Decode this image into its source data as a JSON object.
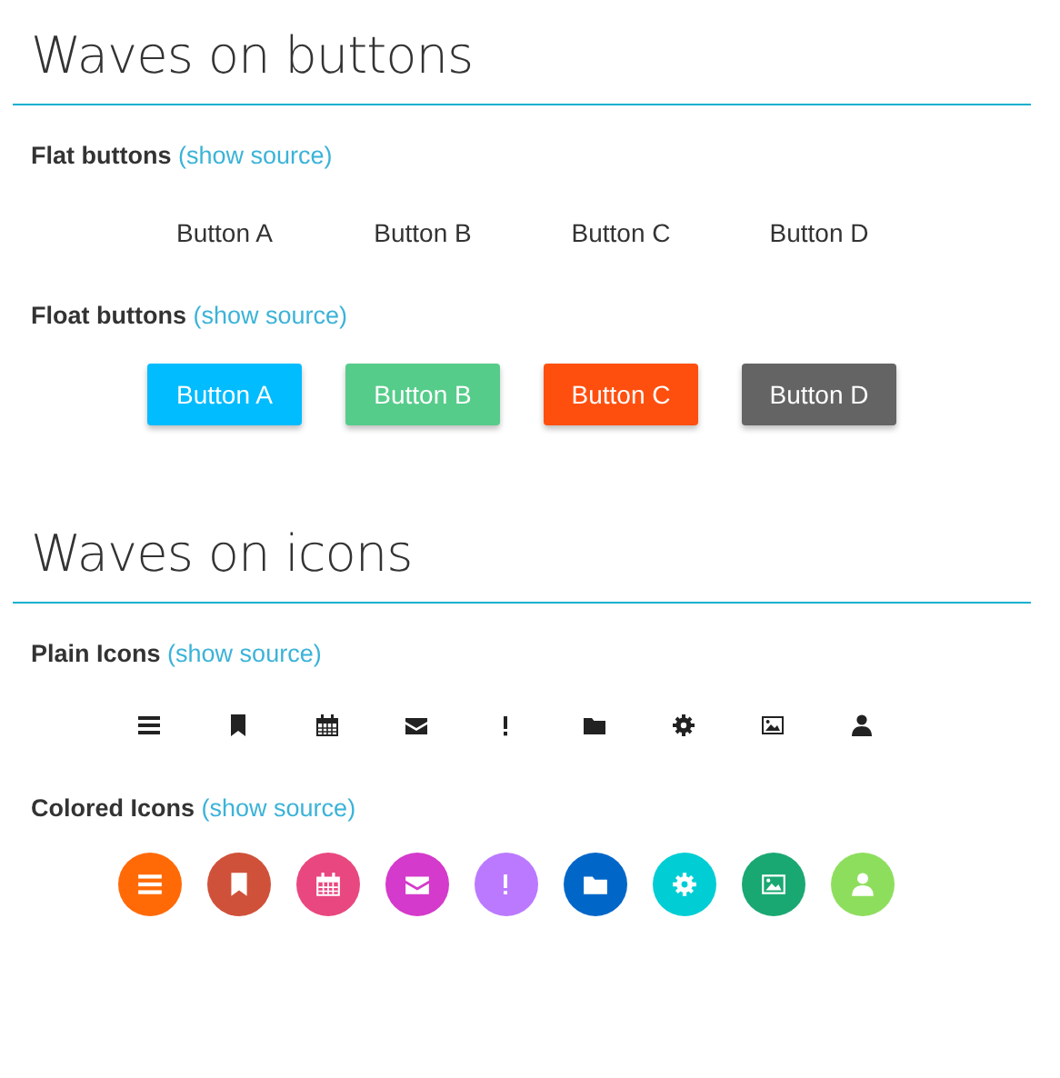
{
  "sections": [
    {
      "title": "Waves on buttons",
      "groups": [
        {
          "label": "Flat buttons",
          "link": "(show source)",
          "kind": "flat",
          "buttons": [
            {
              "label": "Button A"
            },
            {
              "label": "Button B"
            },
            {
              "label": "Button C"
            },
            {
              "label": "Button D"
            }
          ]
        },
        {
          "label": "Float buttons",
          "link": "(show source)",
          "kind": "float",
          "buttons": [
            {
              "label": "Button A",
              "color": "#01bcff"
            },
            {
              "label": "Button B",
              "color": "#56cc8a"
            },
            {
              "label": "Button C",
              "color": "#ff4f0f"
            },
            {
              "label": "Button D",
              "color": "#646464"
            }
          ]
        }
      ]
    },
    {
      "title": "Waves on icons",
      "groups": [
        {
          "label": "Plain Icons",
          "link": "(show source)",
          "kind": "plain",
          "icons": [
            {
              "kind": "menu"
            },
            {
              "kind": "bookmark"
            },
            {
              "kind": "calendar"
            },
            {
              "kind": "envelope"
            },
            {
              "kind": "exclamation"
            },
            {
              "kind": "folder"
            },
            {
              "kind": "gear"
            },
            {
              "kind": "image"
            },
            {
              "kind": "user"
            }
          ]
        },
        {
          "label": "Colored Icons",
          "link": "(show source)",
          "kind": "colored",
          "icons": [
            {
              "kind": "menu",
              "color": "#ff6a07"
            },
            {
              "kind": "bookmark",
              "color": "#d0513a"
            },
            {
              "kind": "calendar",
              "color": "#e9477f"
            },
            {
              "kind": "envelope",
              "color": "#d43acb"
            },
            {
              "kind": "exclamation",
              "color": "#bb79ff"
            },
            {
              "kind": "folder",
              "color": "#0067c8"
            },
            {
              "kind": "gear",
              "color": "#00cdd4"
            },
            {
              "kind": "image",
              "color": "#1aa872"
            },
            {
              "kind": "user",
              "color": "#8ede5e"
            }
          ]
        }
      ]
    }
  ]
}
